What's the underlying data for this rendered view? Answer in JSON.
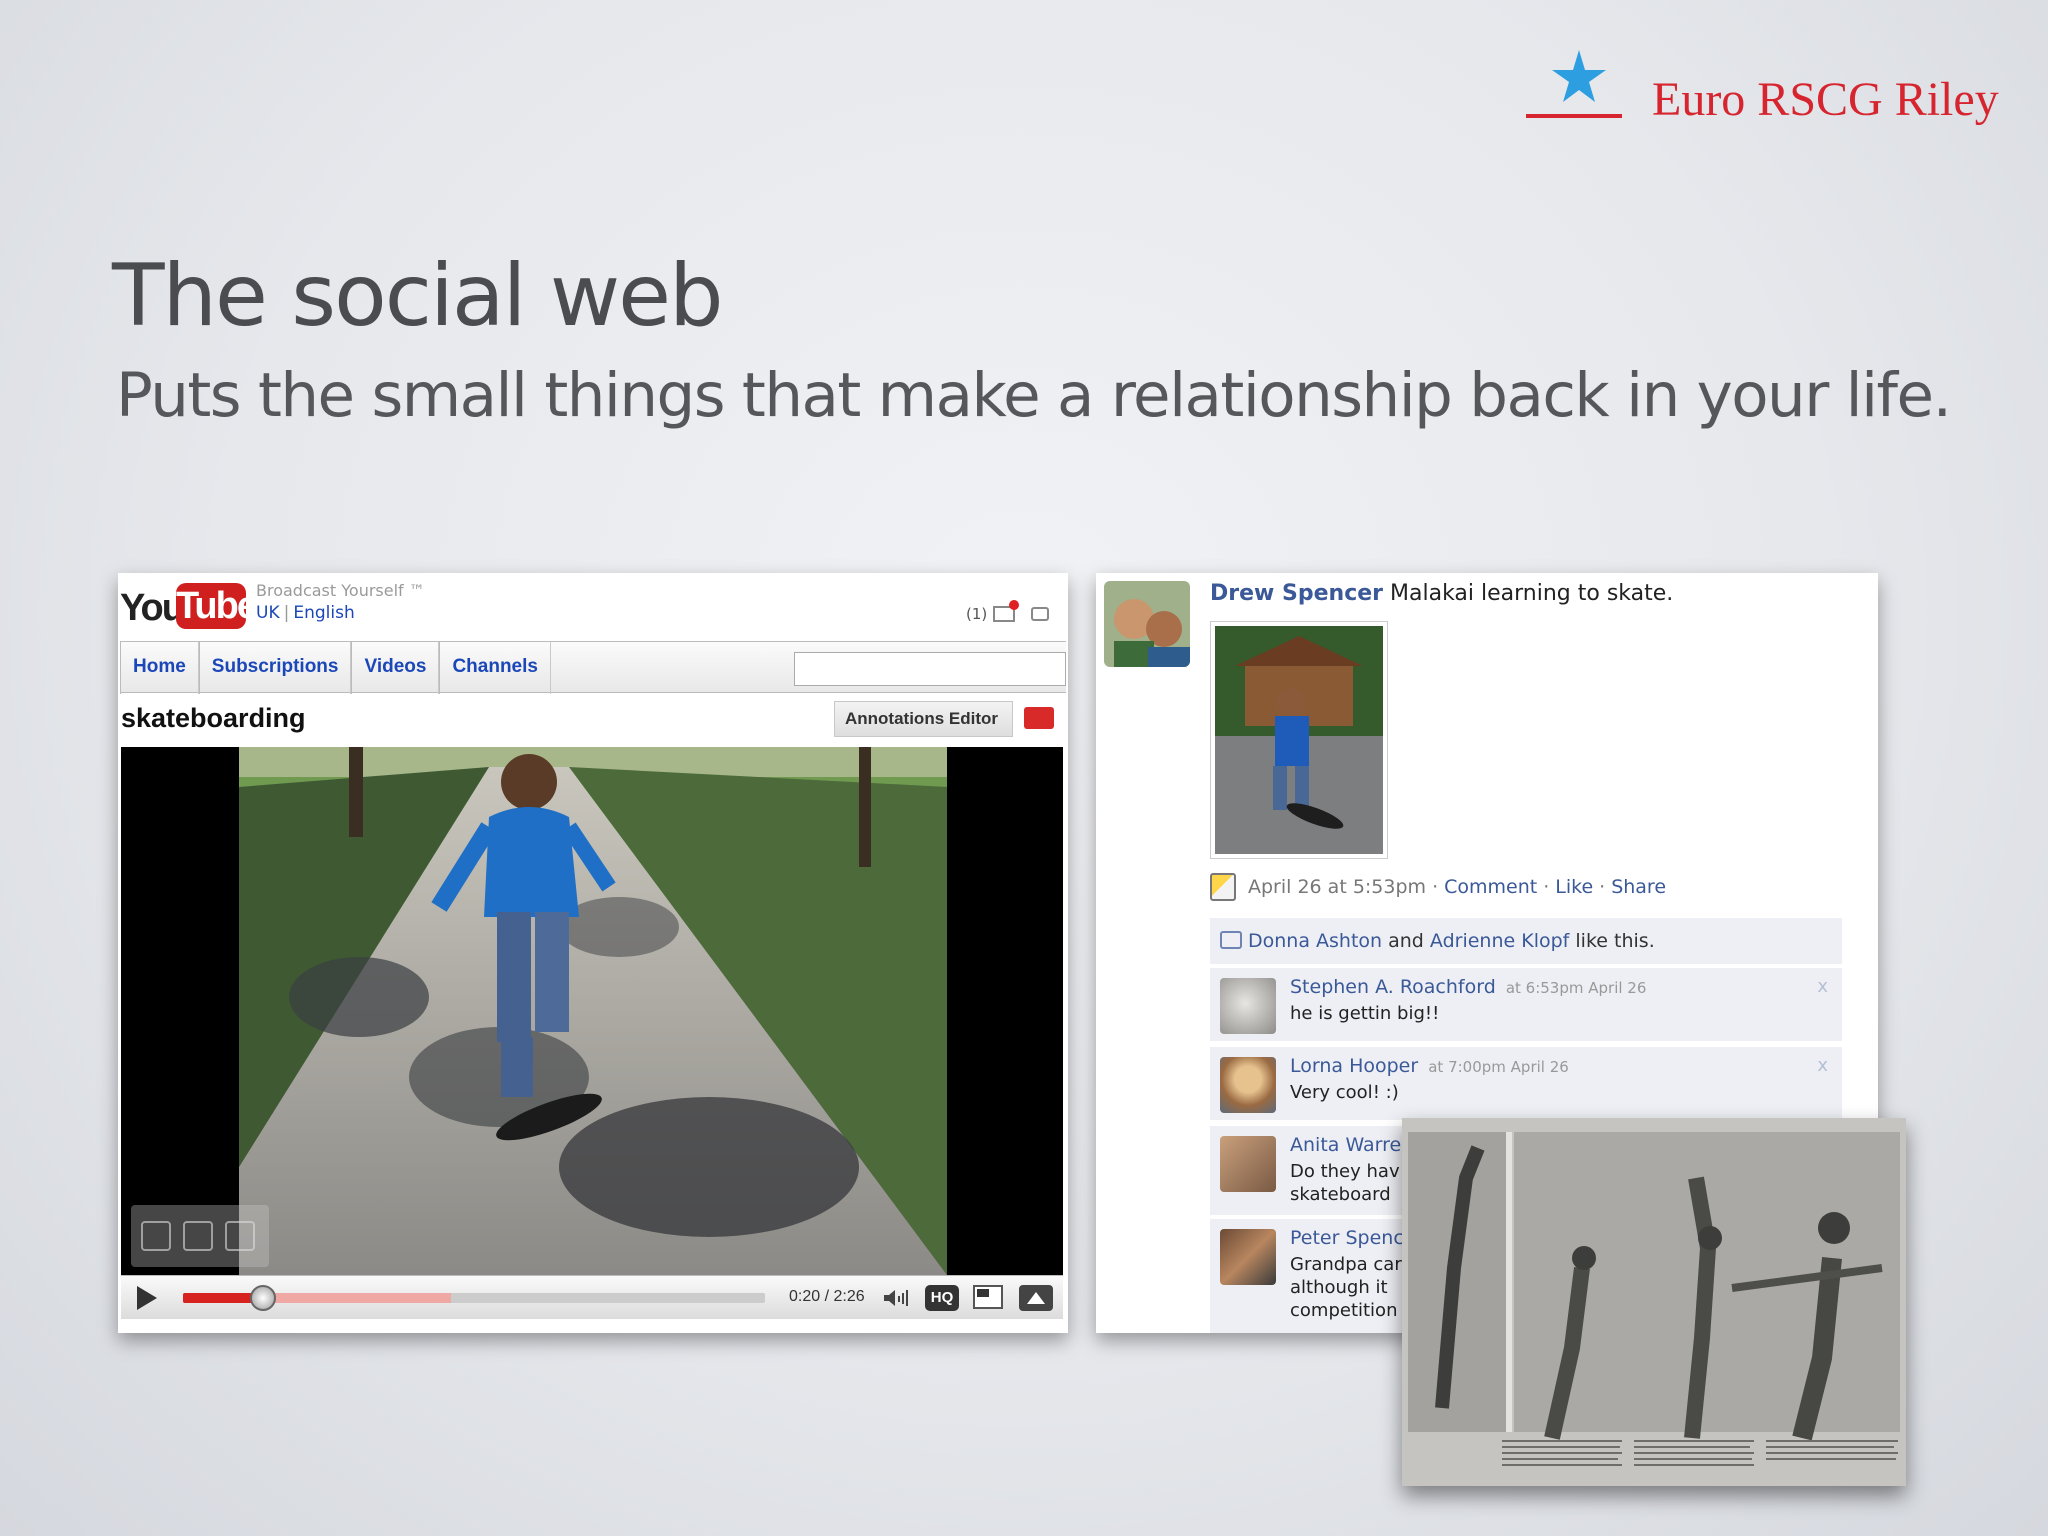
{
  "brand": {
    "name": "Euro RSCG Riley",
    "colors": {
      "red": "#d6252f",
      "star": "#2d9fe0"
    }
  },
  "slide": {
    "title": "The social web",
    "subtitle": "Puts the small things that make a relationship back in your life."
  },
  "youtube": {
    "logo_you": "You",
    "logo_tube": "Tube",
    "tagline": "Broadcast Yourself ™",
    "locale_country": "UK",
    "locale_language": "English",
    "inbox_count": "(1)",
    "nav_tabs": [
      "Home",
      "Subscriptions",
      "Videos",
      "Channels"
    ],
    "search_value": "",
    "video_title": "skateboarding",
    "annotations_button": "Annotations Editor",
    "player": {
      "current_time": "0:20",
      "duration": "2:26",
      "time_display": "0:20 / 2:26",
      "played_fraction": 0.137,
      "loaded_fraction": 0.46,
      "hq_label": "HQ"
    }
  },
  "facebook": {
    "post": {
      "author": "Drew Spencer",
      "text": "Malakai learning to skate.",
      "timestamp": "April 26 at 5:53pm",
      "actions": [
        "Comment",
        "Like",
        "Share"
      ]
    },
    "likes": {
      "names": [
        "Donna Ashton",
        "Adrienne Klopf"
      ],
      "joiner": "and",
      "suffix": "like this."
    },
    "comments": [
      {
        "author": "Stephen A. Roachford",
        "time": "at 6:53pm April 26",
        "text": "he is gettin big!!",
        "removable": true
      },
      {
        "author": "Lorna Hooper",
        "time": "at 7:00pm April 26",
        "text": "Very cool! :)",
        "removable": true
      },
      {
        "author": "Anita Warre",
        "time": "",
        "text": "Do they hav\nskateboard",
        "removable": false
      },
      {
        "author": "Peter Spenc",
        "time": "",
        "text": "Grandpa car\nalthough it \ncompetition",
        "removable": false
      }
    ]
  }
}
